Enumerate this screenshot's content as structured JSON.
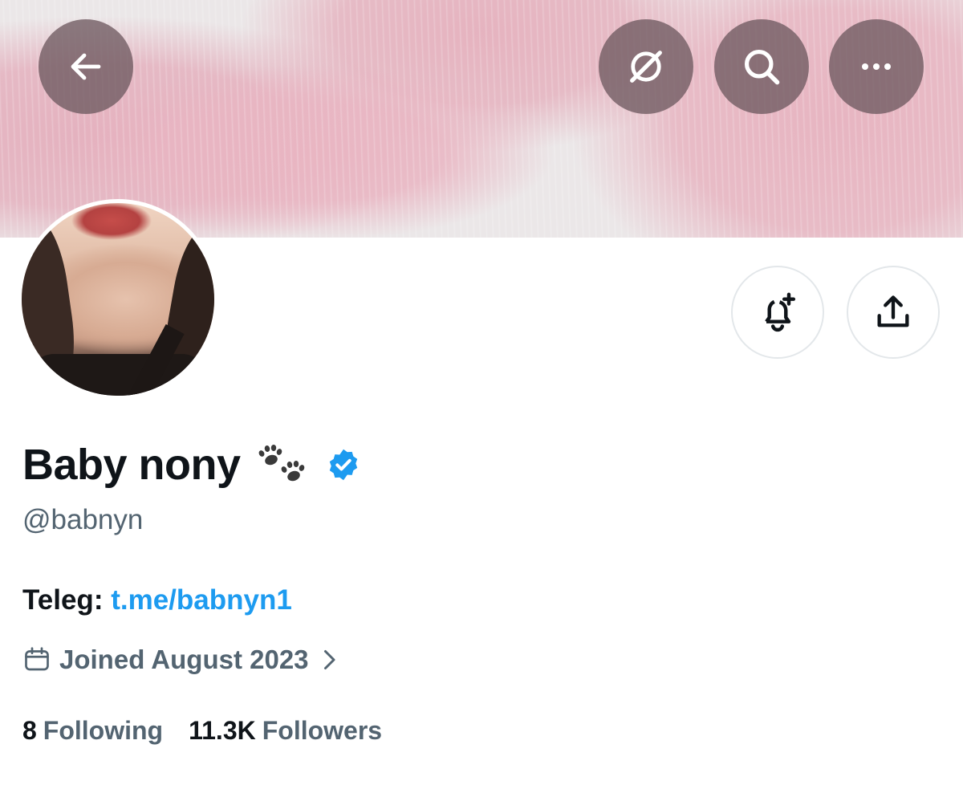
{
  "header": {
    "back_icon": "arrow-left-icon",
    "grok_icon": "grok-icon",
    "search_icon": "search-icon",
    "more_icon": "more-dots-icon"
  },
  "profile": {
    "display_name": "Baby nony",
    "name_emoji": "paw-prints",
    "verified": true,
    "handle": "@babnyn",
    "bio_prefix": "Teleg: ",
    "bio_link": "t.me/babnyn1",
    "joined": "Joined August 2023",
    "following_count": "8",
    "following_label": "Following",
    "followers_count": "11.3K",
    "followers_label": "Followers"
  },
  "actions": {
    "notify_icon": "bell-plus-icon",
    "share_icon": "share-icon"
  },
  "colors": {
    "link": "#1d9bf0",
    "secondary_text": "#536471",
    "primary_text": "#0f1419",
    "verified_badge": "#1d9bf0",
    "banner_pink": "#e4aebc"
  }
}
